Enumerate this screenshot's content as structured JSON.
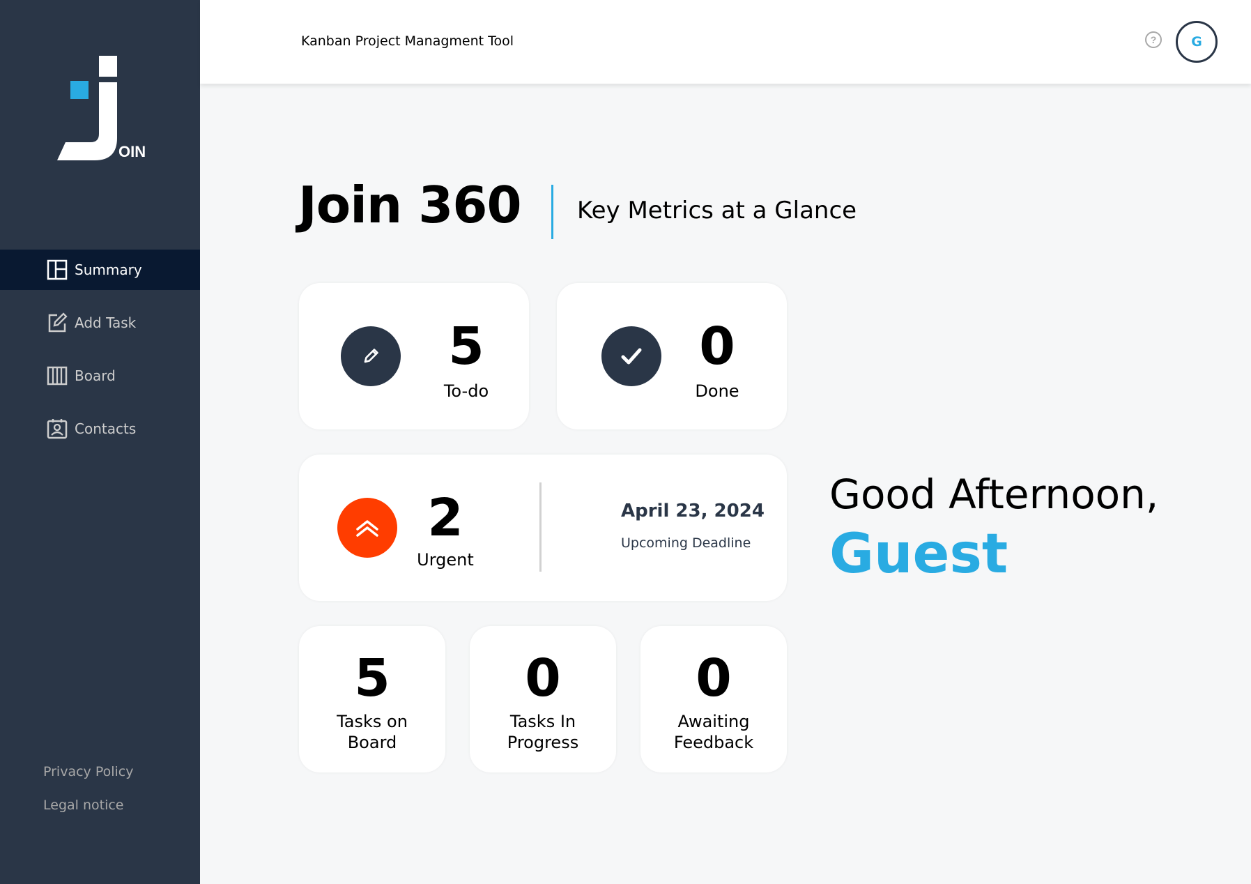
{
  "app": {
    "header_title": "Kanban Project Managment Tool",
    "user_initial": "G"
  },
  "sidebar": {
    "logo_letters": "OIN",
    "items": [
      {
        "label": "Summary",
        "icon": "summary-icon",
        "active": true
      },
      {
        "label": "Add Task",
        "icon": "add-task-icon",
        "active": false
      },
      {
        "label": "Board",
        "icon": "board-icon",
        "active": false
      },
      {
        "label": "Contacts",
        "icon": "contacts-icon",
        "active": false
      }
    ],
    "footer": {
      "privacy": "Privacy Policy",
      "legal": "Legal notice"
    }
  },
  "summary": {
    "title": "Join 360",
    "subtitle": "Key Metrics at a Glance",
    "todo": {
      "count": "5",
      "label": "To-do"
    },
    "done": {
      "count": "0",
      "label": "Done"
    },
    "urgent": {
      "count": "2",
      "label": "Urgent"
    },
    "deadline": {
      "date": "April 23, 2024",
      "label": "Upcoming Deadline"
    },
    "tasks_on_board": {
      "count": "5",
      "label_line1": "Tasks on",
      "label_line2": "Board"
    },
    "tasks_in_progress": {
      "count": "0",
      "label_line1": "Tasks In",
      "label_line2": "Progress"
    },
    "awaiting_feedback": {
      "count": "0",
      "label_line1": "Awaiting",
      "label_line2": "Feedback"
    }
  },
  "greeting": {
    "text": "Good Afternoon,",
    "name": "Guest"
  },
  "colors": {
    "sidebar": "#2a3647",
    "sidebar_active": "#091931",
    "accent": "#29abe2",
    "urgent": "#ff3d00",
    "background": "#f6f7f8"
  }
}
